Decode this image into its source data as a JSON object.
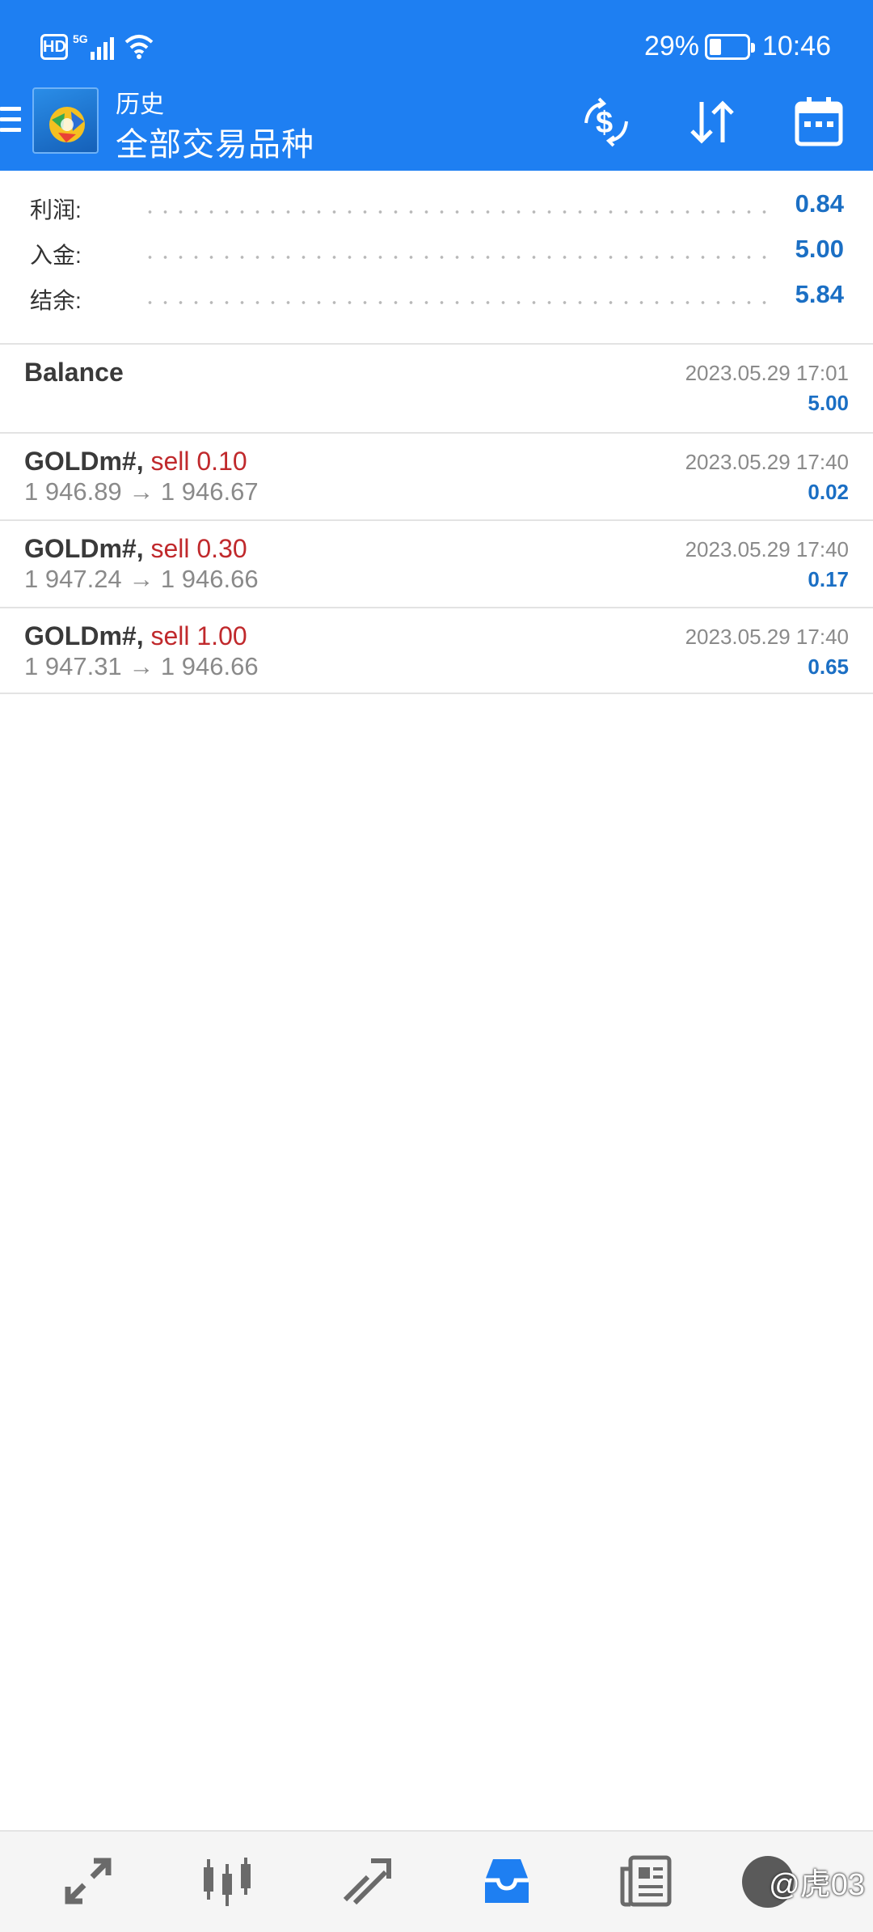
{
  "status_bar": {
    "hd": "HD",
    "network": "5G",
    "battery_percent": "29%",
    "battery_level": 0.29,
    "time": "10:46"
  },
  "header": {
    "title": "历史",
    "subtitle": "全部交易品种",
    "icons": [
      "menu-icon",
      "app-logo",
      "currency-exchange-icon",
      "sort-icon",
      "calendar-icon"
    ]
  },
  "summary": {
    "rows": [
      {
        "label": "利润:",
        "value": "0.84"
      },
      {
        "label": "入金:",
        "value": "5.00"
      },
      {
        "label": "结余:",
        "value": "5.84"
      }
    ]
  },
  "balance": {
    "name": "Balance",
    "time": "2023.05.29 17:01",
    "amount": "5.00"
  },
  "deals": [
    {
      "symbol": "GOLDm#,",
      "action": "sell 0.10",
      "prices": "1 946.89 → 1 946.67",
      "time": "2023.05.29 17:40",
      "profit": "0.02"
    },
    {
      "symbol": "GOLDm#,",
      "action": "sell 0.30",
      "prices": "1 947.24 → 1 946.66",
      "time": "2023.05.29 17:40",
      "profit": "0.17"
    },
    {
      "symbol": "GOLDm#,",
      "action": "sell 1.00",
      "prices": "1 947.31 → 1 946.66",
      "time": "2023.05.29 17:40",
      "profit": "0.65"
    }
  ],
  "bottom_nav": {
    "items": [
      "quotes-icon",
      "chart-icon",
      "trade-icon",
      "history-icon",
      "news-icon",
      "messages-icon"
    ],
    "active": "history-icon",
    "watermark": "@虎03"
  },
  "colors": {
    "header_bg": "#1e7ff2",
    "value_blue": "#1b6fc4",
    "sell_red": "#c0292c",
    "nav_active": "#1e7ff2",
    "nav_inactive": "#6a6a6a"
  }
}
